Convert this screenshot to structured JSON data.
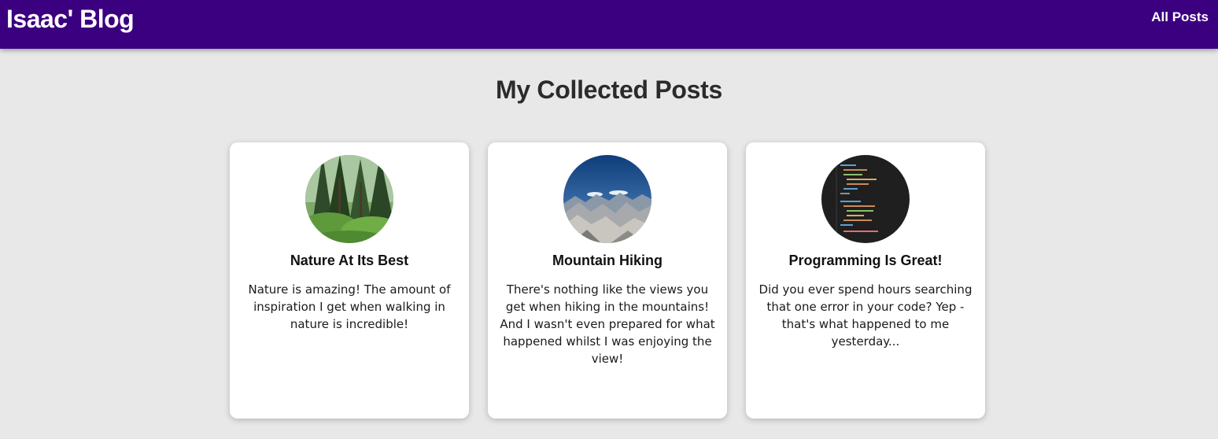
{
  "header": {
    "logo_text": "Isaac' Blog",
    "nav": [
      {
        "label": "All Posts"
      }
    ],
    "background_color": "#3b0080"
  },
  "main": {
    "title": "My Collected Posts",
    "posts": [
      {
        "image_icon": "forest-photo",
        "title": "Nature At Its Best",
        "excerpt": "Nature is amazing! The amount of inspiration I get when walking in nature is incredible!"
      },
      {
        "image_icon": "mountain-photo",
        "title": "Mountain Hiking",
        "excerpt": "There's nothing like the views you get when hiking in the mountains! And I wasn't even prepared for what happened whilst I was enjoying the view!"
      },
      {
        "image_icon": "code-editor-photo",
        "title": "Programming Is Great!",
        "excerpt": "Did you ever spend hours searching that one error in your code? Yep - that's what happened to me yesterday..."
      }
    ]
  }
}
